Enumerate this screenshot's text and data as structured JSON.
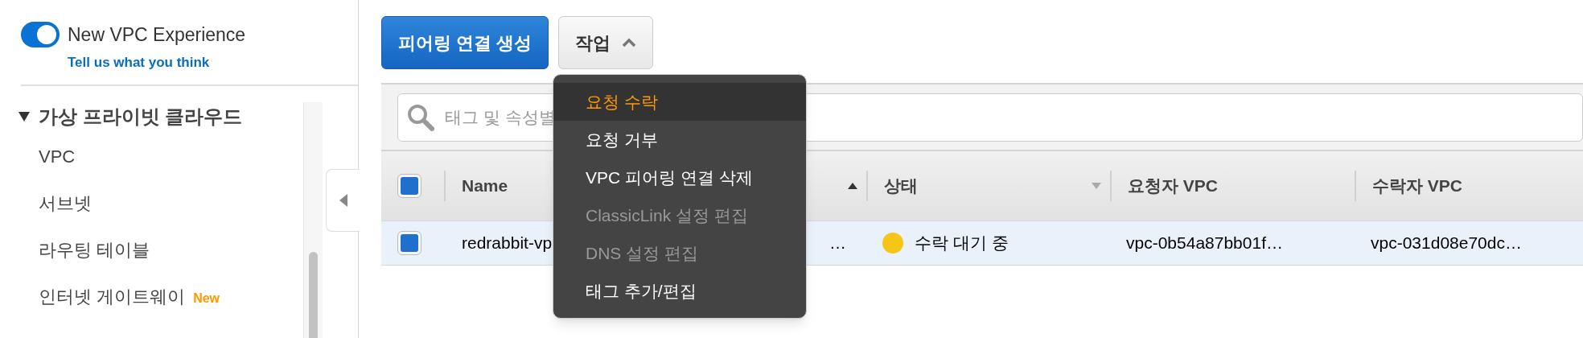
{
  "toggle": {
    "label": "New VPC Experience",
    "on": true,
    "link": "Tell us what you think"
  },
  "sidebar": {
    "section": {
      "label": "가상 프라이빗 클라우드",
      "expanded": true,
      "items": [
        {
          "label": "VPC"
        },
        {
          "label": "서브넷"
        },
        {
          "label": "라우팅 테이블"
        },
        {
          "label": "인터넷 게이트웨이",
          "badge": "New"
        }
      ]
    }
  },
  "toolbar": {
    "buttons": [
      {
        "label": "피어링 연결 생성",
        "kind": "primary"
      },
      {
        "label": "작업",
        "kind": "dropdown",
        "expanded": true
      }
    ]
  },
  "search": {
    "placeholder": "태그 및 속성별"
  },
  "table": {
    "all_checked": true,
    "columns": [
      {
        "label": "Name"
      },
      {
        "sorted": true
      },
      {
        "label": "상태",
        "sorted": false
      },
      {
        "label": "요청자 VPC"
      },
      {
        "label": "수락자 VPC"
      }
    ],
    "rows": [
      {
        "checked": true,
        "selected": true,
        "name": "redrabbit-vp",
        "column_2": "…",
        "status": "수락 대기 중",
        "color": "#f5c518",
        "requester_vpc": "vpc-0b54a87bb01f…",
        "accepter_vpc": "vpc-031d08e70dc…"
      }
    ]
  },
  "menu": {
    "items": [
      {
        "label": "요청 수락",
        "selected": true,
        "disabled": false
      },
      {
        "label": "요청 거부",
        "selected": false,
        "disabled": false
      },
      {
        "label": "VPC 피어링 연결 삭제",
        "selected": false,
        "disabled": false
      },
      {
        "label": "ClassicLink 설정 편집",
        "selected": false,
        "disabled": true
      },
      {
        "label": "DNS 설정 편집",
        "selected": false,
        "disabled": true
      },
      {
        "label": "태그 추가/편집",
        "selected": false,
        "disabled": false
      }
    ]
  }
}
